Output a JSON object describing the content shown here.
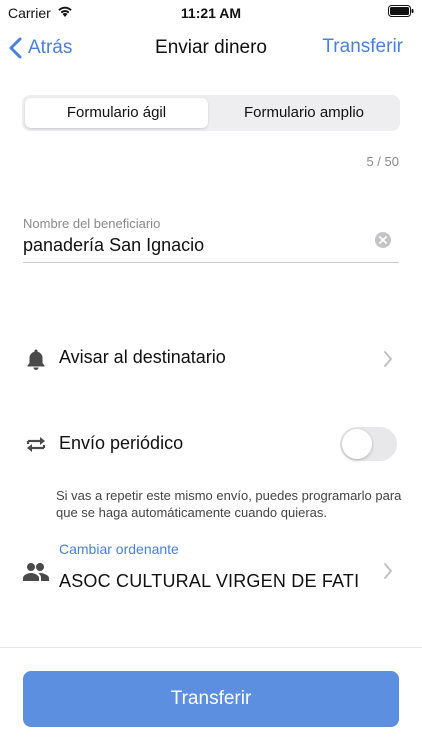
{
  "status_bar": {
    "carrier": "Carrier",
    "time": "11:21 AM"
  },
  "nav": {
    "back_label": "Atrás",
    "title": "Enviar dinero",
    "action_label": "Transferir"
  },
  "segment": {
    "options": [
      "Formulario ágil",
      "Formulario amplio"
    ],
    "selected": 0
  },
  "counter": "5 / 50",
  "beneficiary": {
    "label": "Nombre del beneficiario",
    "value": "panadería San Ignacio"
  },
  "notify": {
    "label": "Avisar al destinatario",
    "icon": "bell-icon"
  },
  "periodic": {
    "label": "Envío periódico",
    "enabled": false,
    "help": "Si vas a repetir este mismo envío, puedes programarlo para que se haga automáticamente cuando quieras.",
    "icon": "repeat-icon"
  },
  "orderer": {
    "link_label": "Cambiar ordenante",
    "name": "ASOC CULTURAL VIRGEN DE FATI",
    "icon": "people-icon"
  },
  "submit_label": "Transferir",
  "colors": {
    "accent": "#4a80d8",
    "button": "#5c8fe0",
    "icon": "#4a4a4a"
  }
}
